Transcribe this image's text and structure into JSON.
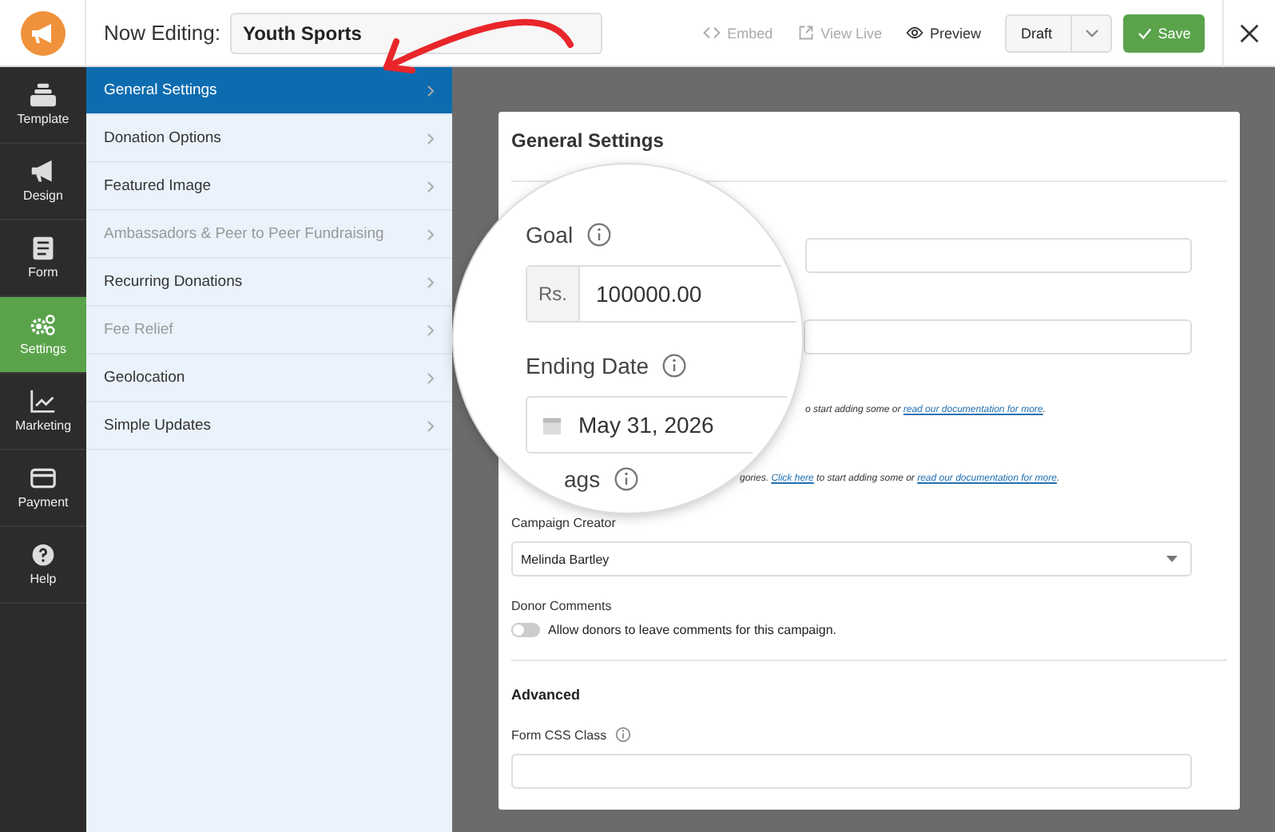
{
  "header": {
    "label": "Now Editing:",
    "title_value": "Youth Sports",
    "actions": [
      {
        "label": "Embed",
        "kind": "embed",
        "disabled": true
      },
      {
        "label": "View Live",
        "kind": "view",
        "disabled": true
      },
      {
        "label": "Preview",
        "kind": "preview",
        "disabled": false
      }
    ],
    "status": "Draft",
    "save": "Save"
  },
  "nav": [
    {
      "label": "Template",
      "kind": "template",
      "selected": false
    },
    {
      "label": "Design",
      "kind": "design",
      "selected": false
    },
    {
      "label": "Form",
      "kind": "form",
      "selected": false
    },
    {
      "label": "Settings",
      "kind": "settings",
      "selected": true
    },
    {
      "label": "Marketing",
      "kind": "marketing",
      "selected": false
    },
    {
      "label": "Payment",
      "kind": "payment",
      "selected": false
    },
    {
      "label": "Help",
      "kind": "help",
      "selected": false
    }
  ],
  "submenu": [
    {
      "label": "General Settings",
      "selected": true,
      "disabled": false
    },
    {
      "label": "Donation Options",
      "selected": false,
      "disabled": false
    },
    {
      "label": "Featured Image",
      "selected": false,
      "disabled": false
    },
    {
      "label": "Ambassadors & Peer to Peer Fundraising",
      "selected": false,
      "disabled": true
    },
    {
      "label": "Recurring Donations",
      "selected": false,
      "disabled": false
    },
    {
      "label": "Fee Relief",
      "selected": false,
      "disabled": true
    },
    {
      "label": "Geolocation",
      "selected": false,
      "disabled": false
    },
    {
      "label": "Simple Updates",
      "selected": false,
      "disabled": false
    }
  ],
  "card": {
    "title": "General Settings",
    "notes": [
      [
        {
          "kind": "text",
          "text": "o start adding some or "
        },
        {
          "kind": "link",
          "text": "read our documentation for more"
        },
        {
          "kind": "text",
          "text": "."
        }
      ],
      [
        {
          "kind": "text",
          "text": "gories. "
        },
        {
          "kind": "link",
          "text": "Click here"
        },
        {
          "kind": "text",
          "text": " to start adding some or "
        },
        {
          "kind": "link",
          "text": "read our documentation for more"
        },
        {
          "kind": "text",
          "text": "."
        }
      ]
    ],
    "creator_label": "Campaign Creator",
    "creator_value": "Melinda Bartley",
    "comments_label": "Donor Comments",
    "comments_toggle": {
      "label": "Allow donors to leave comments for this campaign.",
      "on": false
    },
    "advanced": "Advanced",
    "css_label": "Form CSS Class"
  },
  "magnifier": {
    "goal_label": "Goal",
    "currency": "Rs.",
    "goal_value": "100000.00",
    "date_label": "Ending Date",
    "date_value": "May 31, 2026",
    "tags_label": "ags"
  }
}
